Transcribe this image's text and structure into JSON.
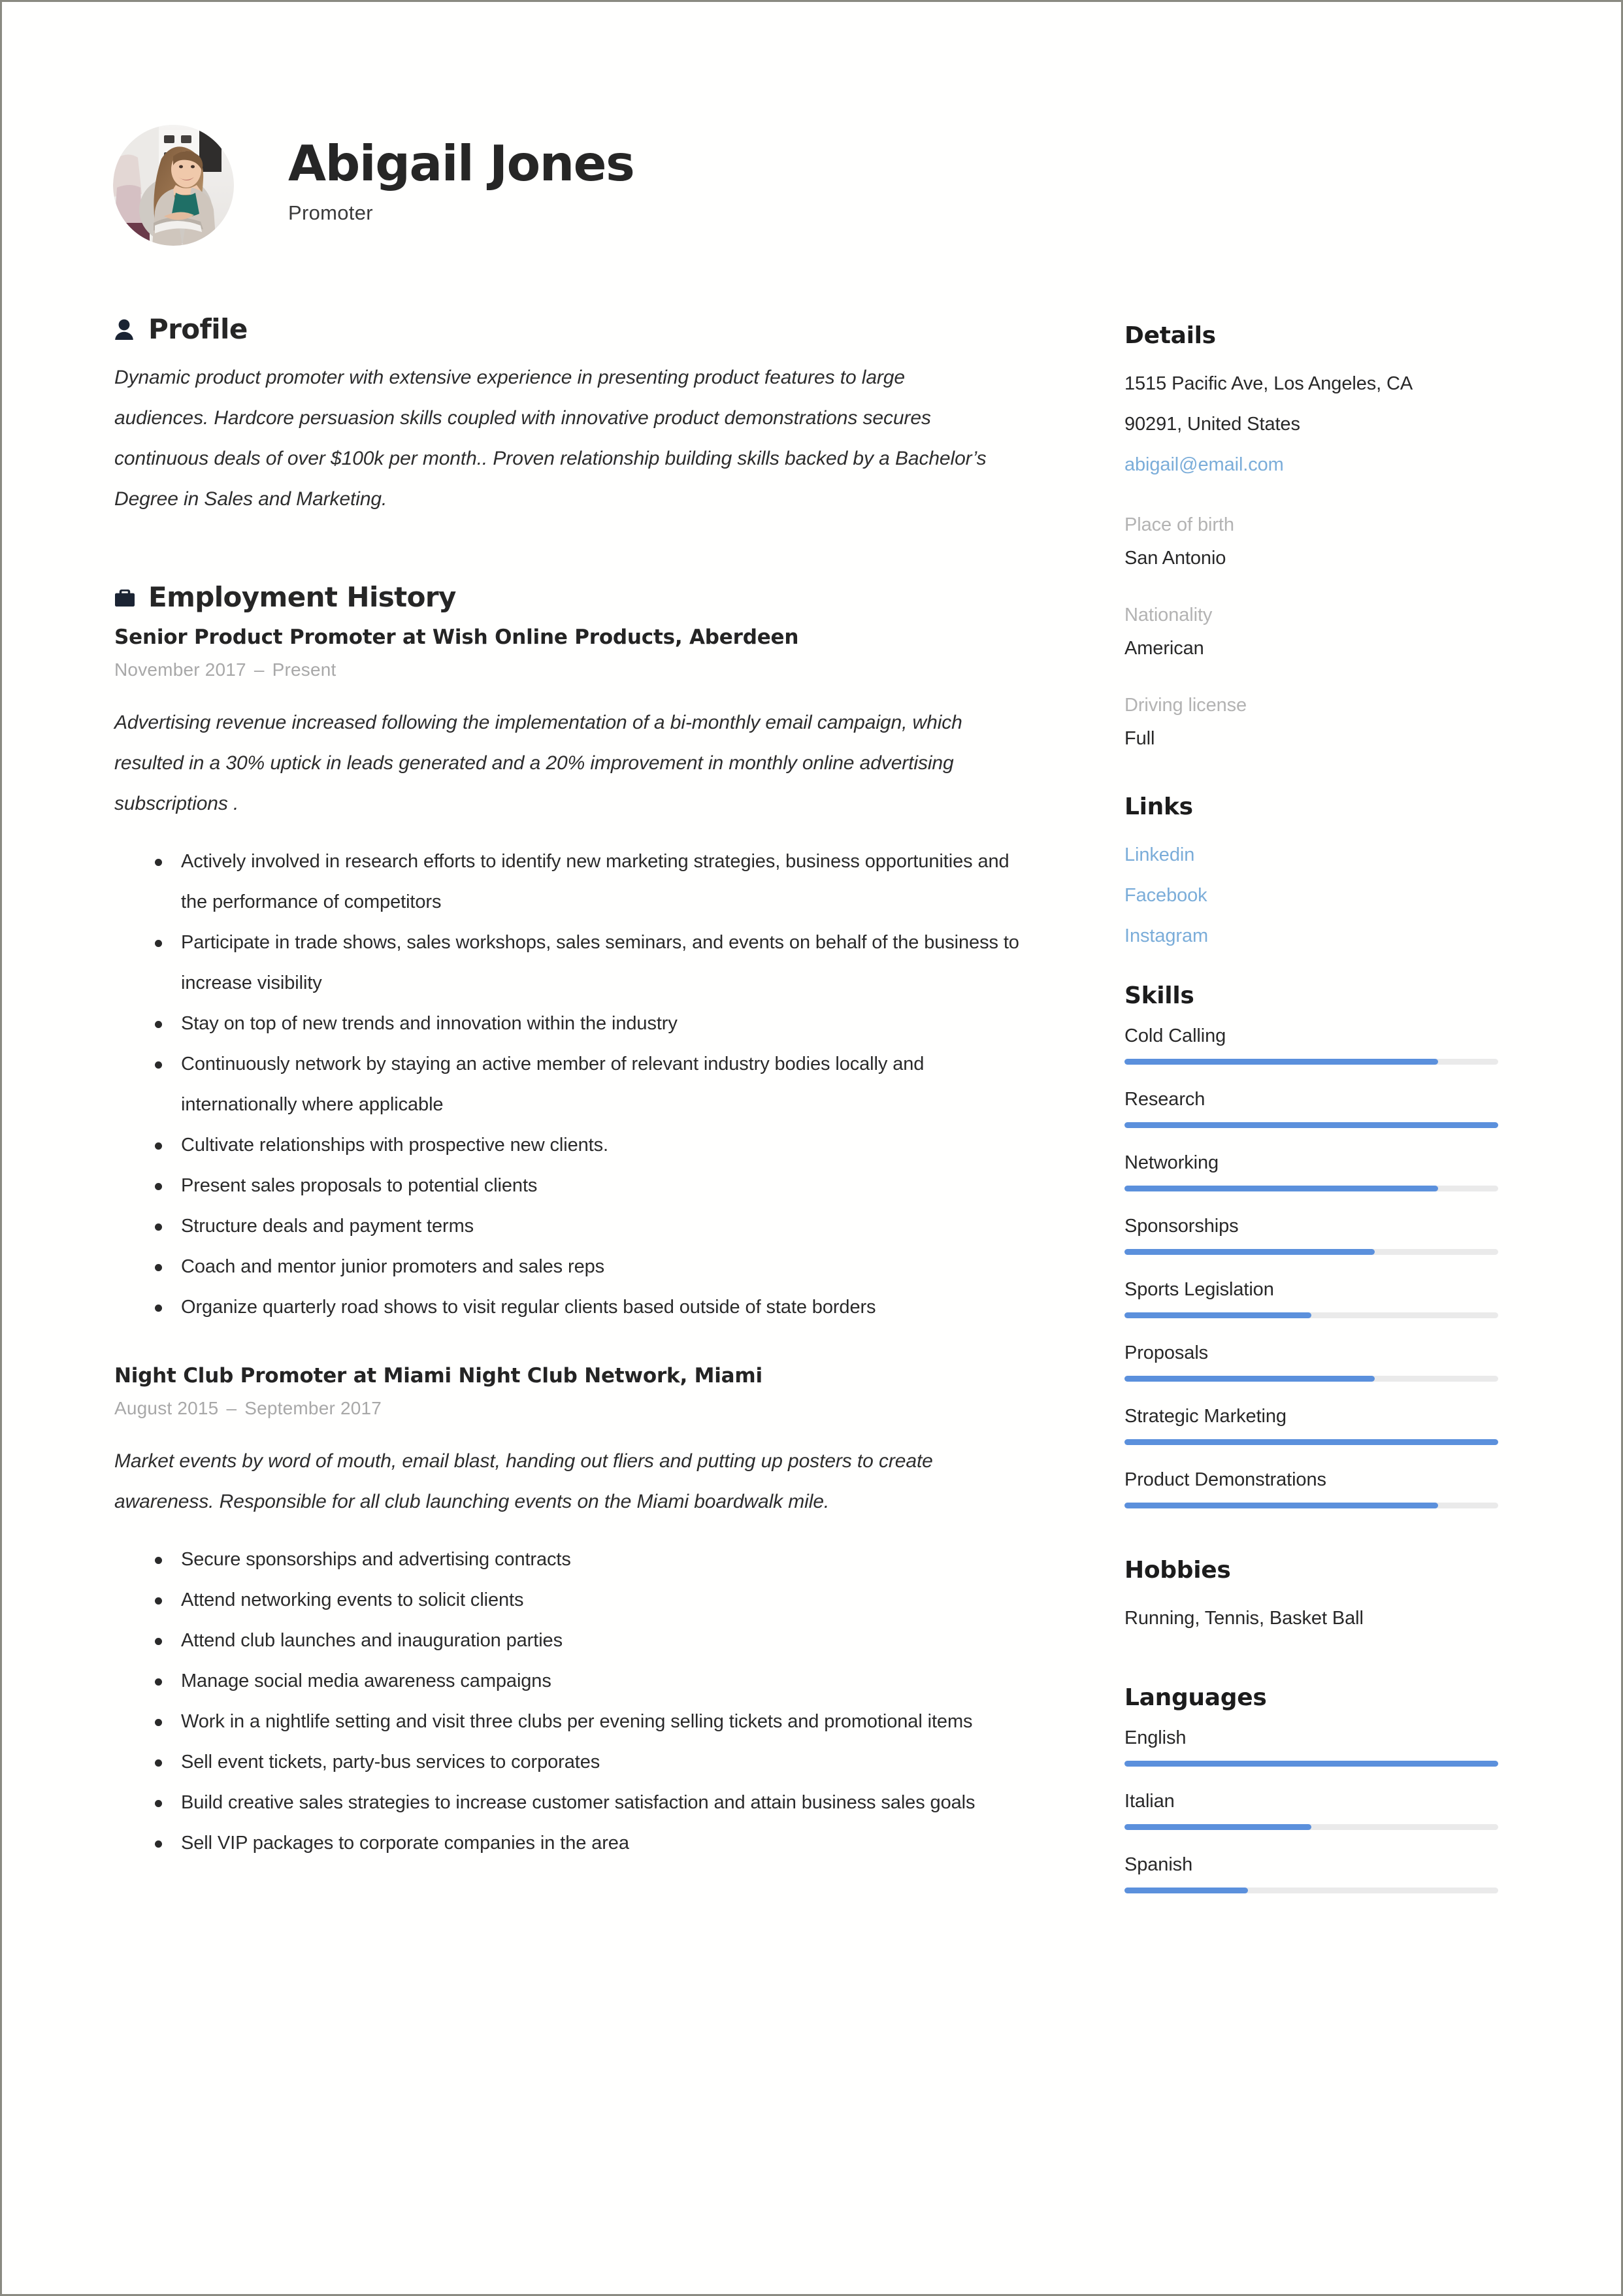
{
  "accent_color": "#5b90dc",
  "link_color": "#7badd9",
  "header": {
    "name": "Abigail Jones",
    "job_title": "Promoter",
    "avatar_alt": "avatar-photo"
  },
  "profile": {
    "section_title": "Profile",
    "icon": "person-icon",
    "text": "Dynamic product promoter with extensive experience in presenting product features to large audiences. Hardcore persuasion skills coupled with innovative product demonstrations secures continuous deals of over $100k per month.. Proven relationship building skills backed by a Bachelor’s Degree in Sales and Marketing."
  },
  "employment": {
    "section_title": "Employment History",
    "icon": "briefcase-icon",
    "jobs": [
      {
        "title": "Senior Product Promoter at Wish Online Products, Aberdeen",
        "start_date": "November 2017",
        "end_date": "Present",
        "dash": "–",
        "description": "Advertising revenue increased following the implementation of a bi-monthly email campaign, which resulted in a 30% uptick in leads generated and a 20% improvement in monthly online advertising subscriptions .",
        "bullets": [
          "Actively involved in research efforts to identify new marketing strategies, business opportunities and the performance of competitors",
          "Participate in trade shows, sales workshops, sales seminars, and events on behalf of the business to increase visibility",
          "Stay on top of new trends and innovation within the industry",
          "Continuously network by staying an active member of relevant industry bodies locally and internationally where applicable",
          "Cultivate relationships with prospective new clients.",
          "Present sales proposals to potential clients",
          "Structure deals and payment terms",
          "Coach and mentor junior promoters and sales reps",
          "Organize quarterly road shows to visit regular clients based outside of state borders"
        ]
      },
      {
        "title": "Night Club Promoter at Miami Night Club Network, Miami",
        "start_date": "August 2015",
        "end_date": "September 2017",
        "dash": "–",
        "description": "Market events by word of mouth, email blast, handing out fliers and putting up posters to create awareness. Responsible for all club launching events on the Miami boardwalk mile.",
        "bullets": [
          "Secure sponsorships and advertising contracts",
          "Attend networking events to solicit clients",
          "Attend club launches and inauguration parties",
          "Manage social media awareness campaigns",
          "Work in a nightlife setting and visit three clubs per evening selling tickets and promotional items",
          "Sell event tickets, party-bus services to corporates",
          "Build creative sales strategies to increase customer satisfaction and attain business sales goals",
          "Sell VIP packages to corporate companies in the area"
        ]
      }
    ]
  },
  "details": {
    "section_title": "Details",
    "address_line_1": "1515 Pacific Ave, Los Angeles, CA",
    "address_line_2": "90291, United States",
    "email": "abigail@email.com",
    "fields": [
      {
        "label": "Place of birth",
        "value": "San Antonio"
      },
      {
        "label": "Nationality",
        "value": "American"
      },
      {
        "label": "Driving license",
        "value": "Full"
      }
    ]
  },
  "links": {
    "section_title": "Links",
    "items": [
      {
        "label": "Linkedin"
      },
      {
        "label": "Facebook"
      },
      {
        "label": "Instagram"
      }
    ]
  },
  "skills": {
    "section_title": "Skills",
    "items": [
      {
        "label": "Cold Calling",
        "level": 84
      },
      {
        "label": "Research",
        "level": 100
      },
      {
        "label": "Networking",
        "level": 84
      },
      {
        "label": "Sponsorships",
        "level": 67
      },
      {
        "label": "Sports Legislation",
        "level": 50
      },
      {
        "label": "Proposals",
        "level": 67
      },
      {
        "label": "Strategic Marketing",
        "level": 100
      },
      {
        "label": "Product Demonstrations",
        "level": 84
      }
    ]
  },
  "hobbies": {
    "section_title": "Hobbies",
    "text": "Running, Tennis, Basket Ball"
  },
  "languages": {
    "section_title": "Languages",
    "items": [
      {
        "label": "English",
        "level": 100
      },
      {
        "label": "Italian",
        "level": 50
      },
      {
        "label": "Spanish",
        "level": 33
      }
    ]
  }
}
